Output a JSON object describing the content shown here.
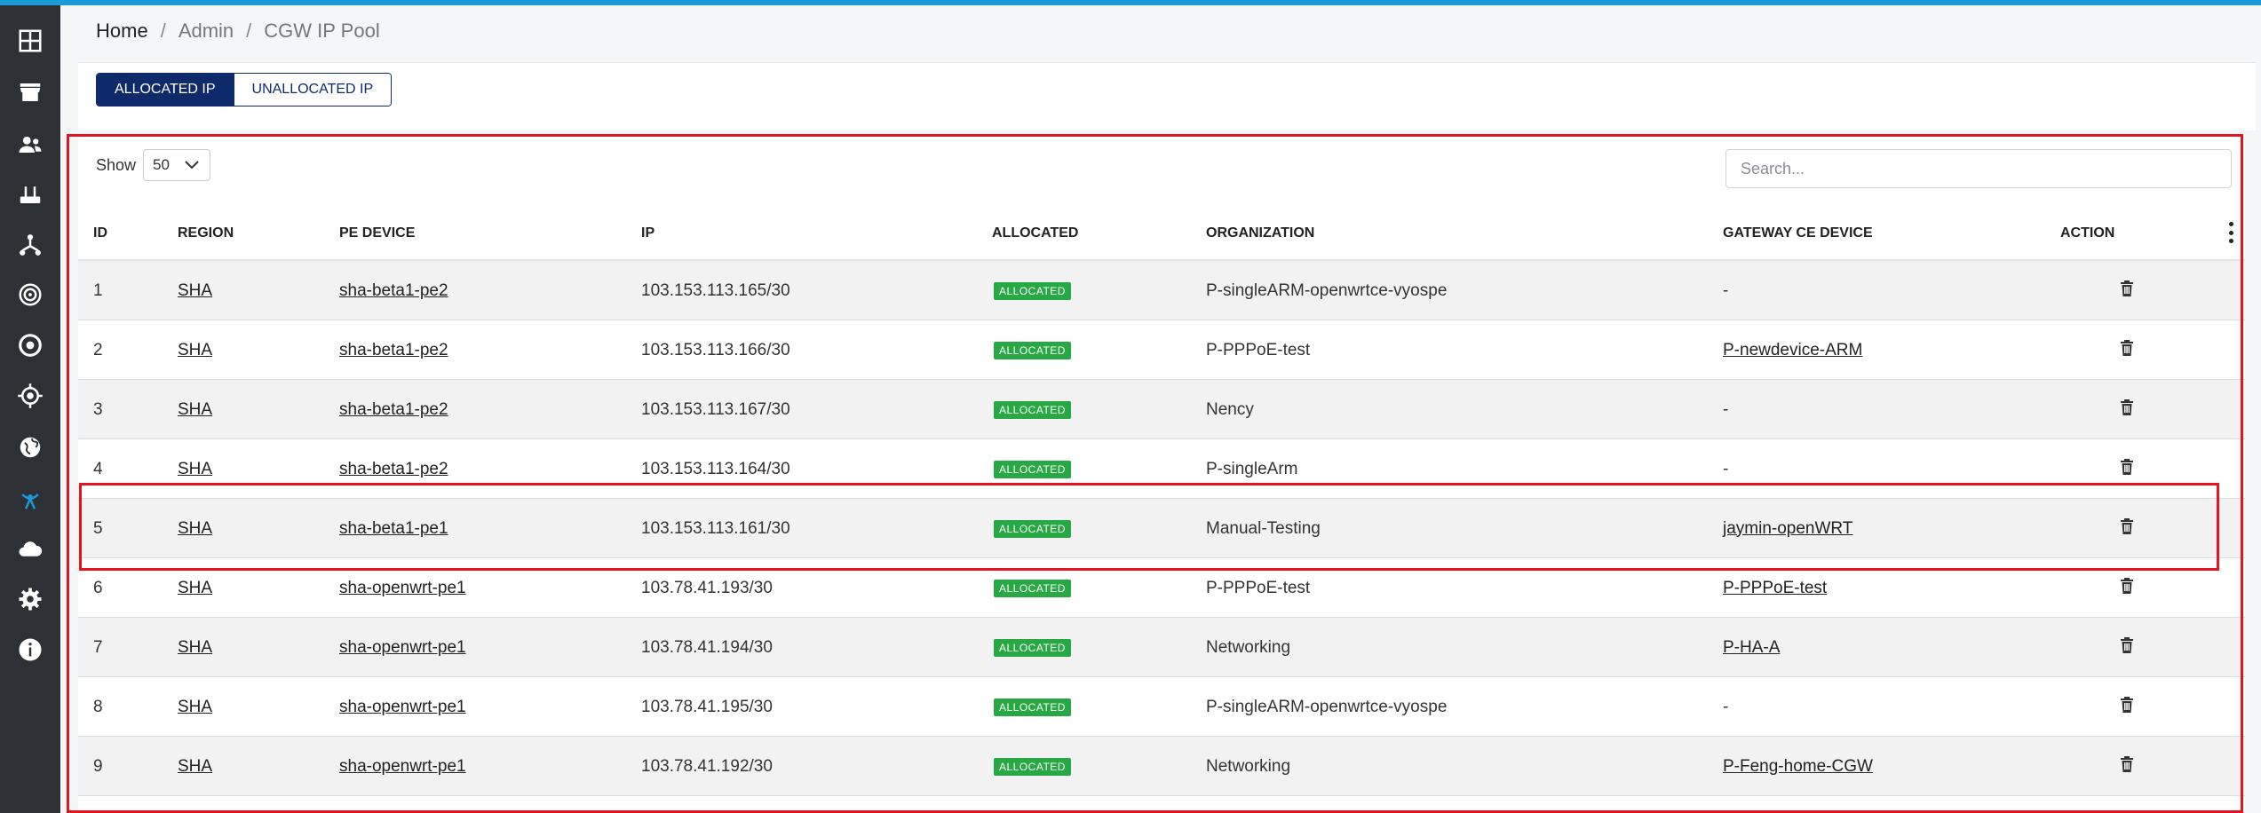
{
  "breadcrumb": {
    "home": "Home",
    "admin": "Admin",
    "current": "CGW IP Pool"
  },
  "tabs": {
    "allocated": "ALLOCATED IP",
    "unallocated": "UNALLOCATED IP"
  },
  "table_controls": {
    "show_label": "Show",
    "page_size": "50",
    "search_placeholder": "Search..."
  },
  "columns": [
    "ID",
    "REGION",
    "PE DEVICE",
    "IP",
    "ALLOCATED",
    "ORGANIZATION",
    "GATEWAY CE DEVICE",
    "ACTION"
  ],
  "rows": [
    {
      "id": "1",
      "region": "SHA",
      "pe": "sha-beta1-pe2",
      "ip": "103.153.113.165/30",
      "status": "ALLOCATED",
      "org": "P-singleARM-openwrtce-vyospe",
      "ce": "-"
    },
    {
      "id": "2",
      "region": "SHA",
      "pe": "sha-beta1-pe2",
      "ip": "103.153.113.166/30",
      "status": "ALLOCATED",
      "org": "P-PPPoE-test",
      "ce": "P-newdevice-ARM"
    },
    {
      "id": "3",
      "region": "SHA",
      "pe": "sha-beta1-pe2",
      "ip": "103.153.113.167/30",
      "status": "ALLOCATED",
      "org": "Nency",
      "ce": "-"
    },
    {
      "id": "4",
      "region": "SHA",
      "pe": "sha-beta1-pe2",
      "ip": "103.153.113.164/30",
      "status": "ALLOCATED",
      "org": "P-singleArm",
      "ce": "-"
    },
    {
      "id": "5",
      "region": "SHA",
      "pe": "sha-beta1-pe1",
      "ip": "103.153.113.161/30",
      "status": "ALLOCATED",
      "org": "Manual-Testing",
      "ce": "jaymin-openWRT"
    },
    {
      "id": "6",
      "region": "SHA",
      "pe": "sha-openwrt-pe1",
      "ip": "103.78.41.193/30",
      "status": "ALLOCATED",
      "org": "P-PPPoE-test",
      "ce": "P-PPPoE-test"
    },
    {
      "id": "7",
      "region": "SHA",
      "pe": "sha-openwrt-pe1",
      "ip": "103.78.41.194/30",
      "status": "ALLOCATED",
      "org": "Networking",
      "ce": "P-HA-A"
    },
    {
      "id": "8",
      "region": "SHA",
      "pe": "sha-openwrt-pe1",
      "ip": "103.78.41.195/30",
      "status": "ALLOCATED",
      "org": "P-singleARM-openwrtce-vyospe",
      "ce": "-"
    },
    {
      "id": "9",
      "region": "SHA",
      "pe": "sha-openwrt-pe1",
      "ip": "103.78.41.192/30",
      "status": "ALLOCATED",
      "org": "Networking",
      "ce": "P-Feng-home-CGW"
    }
  ],
  "sidebar_icons": [
    "dashboard-icon",
    "store-icon",
    "users-icon",
    "router-icon",
    "network-icon",
    "radar-icon",
    "target-icon",
    "crosshair-icon",
    "globe-icon",
    "antenna-icon",
    "cloud-icon",
    "gear-icon",
    "info-icon"
  ],
  "colors": {
    "accent": "#1a9bd7",
    "sidebar": "#2d3035",
    "badge": "#27a844",
    "tab_active": "#0f2a6b",
    "highlight": "#e3141f"
  }
}
